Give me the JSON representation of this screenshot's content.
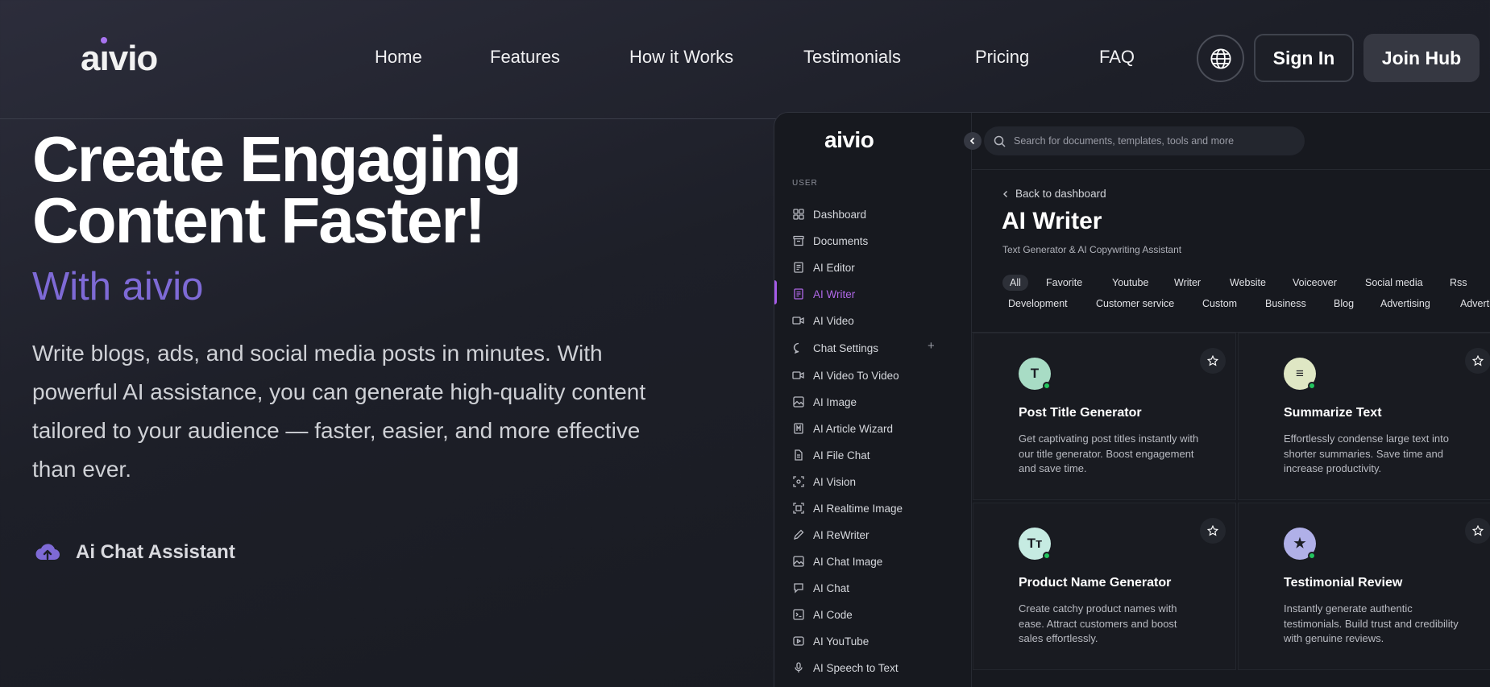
{
  "site": {
    "logo": "aivio",
    "nav": [
      "Home",
      "Features",
      "How it Works",
      "Testimonials",
      "Pricing",
      "FAQ"
    ],
    "signin_label": "Sign In",
    "join_label": "Join Hub"
  },
  "hero": {
    "title_line1": "Create Engaging",
    "title_line2": "Content Faster!",
    "subtitle": "With aivio",
    "description": "Write blogs, ads, and social media posts in minutes. With powerful AI assistance, you can generate high-quality content tailored to your audience — faster, easier, and more effective than ever.",
    "feature_label": "Ai Chat Assistant"
  },
  "app": {
    "logo": "aivio",
    "search_placeholder": "Search for documents, templates, tools and more",
    "user_label": "USER",
    "menu": [
      {
        "label": "Dashboard",
        "icon": "grid-icon"
      },
      {
        "label": "Documents",
        "icon": "archive-icon"
      },
      {
        "label": "AI Editor",
        "icon": "document-icon"
      },
      {
        "label": "AI Writer",
        "icon": "document-icon",
        "active": true
      },
      {
        "label": "AI Video",
        "icon": "video-icon"
      },
      {
        "label": "Chat Settings",
        "icon": "chat-bubble-icon"
      },
      {
        "label": "AI Video To Video",
        "icon": "video-icon"
      },
      {
        "label": "AI Image",
        "icon": "image-icon"
      },
      {
        "label": "AI Article Wizard",
        "icon": "wizard-icon"
      },
      {
        "label": "AI File Chat",
        "icon": "file-icon"
      },
      {
        "label": "AI Vision",
        "icon": "eye-icon"
      },
      {
        "label": "AI Realtime Image",
        "icon": "image-icon"
      },
      {
        "label": "AI ReWriter",
        "icon": "pen-icon"
      },
      {
        "label": "AI Chat Image",
        "icon": "image-icon"
      },
      {
        "label": "AI Chat",
        "icon": "chat-bubble-icon"
      },
      {
        "label": "AI Code",
        "icon": "terminal-icon"
      },
      {
        "label": "AI YouTube",
        "icon": "play-icon"
      },
      {
        "label": "AI Speech to Text",
        "icon": "microphone-icon"
      }
    ],
    "back_label": "Back to dashboard",
    "page_title": "AI Writer",
    "page_subtitle": "Text Generator & AI Copywriting Assistant",
    "filters_row1": [
      "All",
      "Favorite",
      "Youtube",
      "Writer",
      "Website",
      "Voiceover",
      "Social media",
      "Rss"
    ],
    "filters_row2": [
      "Development",
      "Customer service",
      "Custom",
      "Business",
      "Blog",
      "Advertising",
      "Advertising"
    ],
    "cards": [
      {
        "title": "Post Title Generator",
        "desc": "Get captivating post titles instantly with our title generator. Boost engagement and save time.",
        "glyph": "T",
        "color": "#a8dcc5"
      },
      {
        "title": "Summarize Text",
        "desc": "Effortlessly condense large text into shorter summaries. Save time and increase productivity.",
        "glyph": "≡",
        "color": "#dfe7c4"
      },
      {
        "title": "Product Name Generator",
        "desc": "Create catchy product names with ease. Attract customers and boost sales effortlessly.",
        "glyph": "Tт",
        "color": "#c6ebe2"
      },
      {
        "title": "Testimonial Review",
        "desc": "Instantly generate authentic testimonials. Build trust and credibility with genuine reviews.",
        "glyph": "★",
        "color": "#b0b0e8"
      }
    ]
  }
}
